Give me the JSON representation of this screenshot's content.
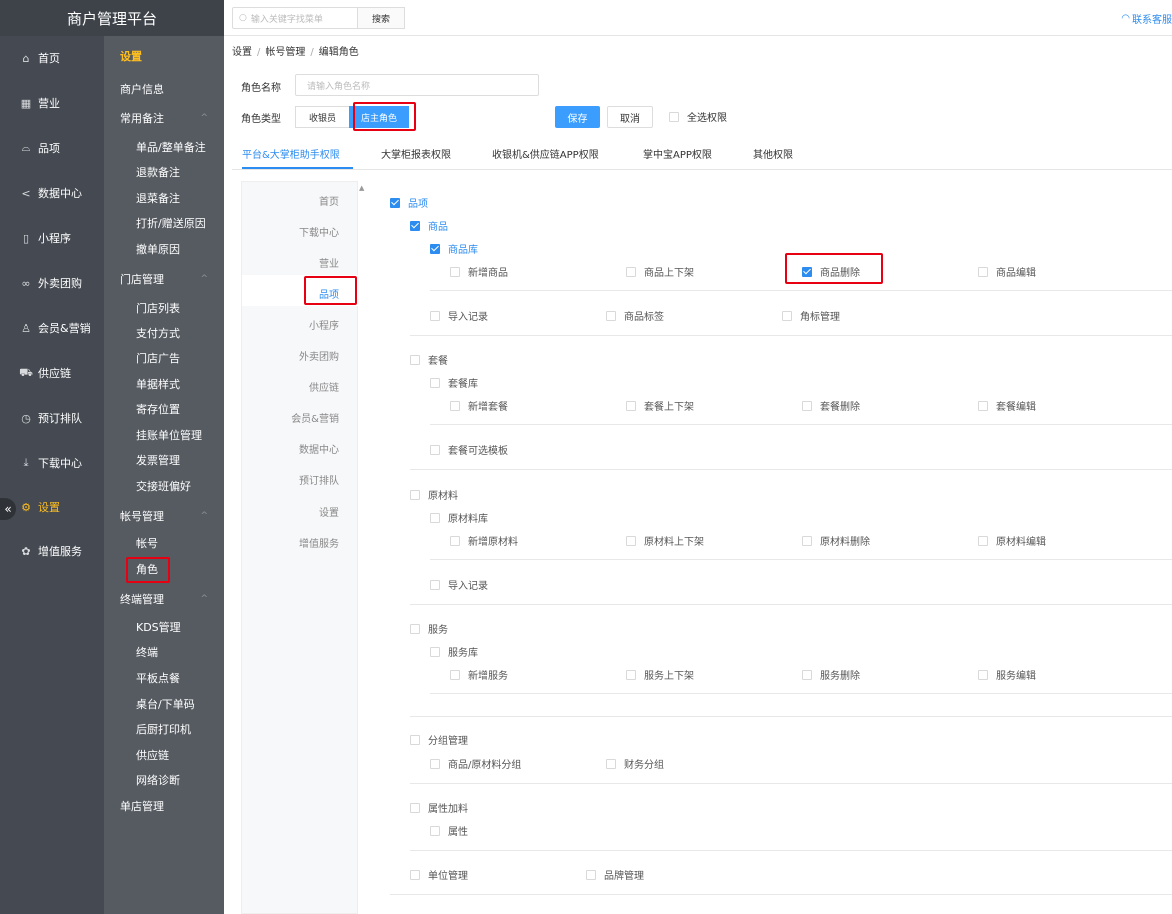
{
  "app": {
    "title": "商户管理平台"
  },
  "rail": [
    {
      "label": "首页",
      "icon": "home-icon",
      "glyph": "⌂"
    },
    {
      "label": "营业",
      "icon": "calendar-icon",
      "glyph": "▦"
    },
    {
      "label": "品项",
      "icon": "bag-icon",
      "glyph": "⌓"
    },
    {
      "label": "数据中心",
      "icon": "share-icon",
      "glyph": "<"
    },
    {
      "label": "小程序",
      "icon": "tablet-icon",
      "glyph": "▯"
    },
    {
      "label": "外卖团购",
      "icon": "bike-icon",
      "glyph": "∞"
    },
    {
      "label": "会员&营销",
      "icon": "user-icon",
      "glyph": "♙"
    },
    {
      "label": "供应链",
      "icon": "truck-icon",
      "glyph": "⛟"
    },
    {
      "label": "预订排队",
      "icon": "clock-icon",
      "glyph": "◷"
    },
    {
      "label": "下载中心",
      "icon": "download-icon",
      "glyph": "⤓"
    },
    {
      "label": "设置",
      "icon": "gear-icon",
      "glyph": "⚙"
    },
    {
      "label": "增值服务",
      "icon": "gift-icon",
      "glyph": "✿"
    }
  ],
  "sub": {
    "title": "设置",
    "items": [
      {
        "t": "c0",
        "label": "商户信息"
      },
      {
        "t": "h",
        "label": "常用备注"
      },
      {
        "t": "c",
        "label": "单品/整单备注"
      },
      {
        "t": "c",
        "label": "退款备注"
      },
      {
        "t": "c",
        "label": "退菜备注"
      },
      {
        "t": "c",
        "label": "打折/赠送原因"
      },
      {
        "t": "c",
        "label": "撤单原因"
      },
      {
        "t": "h",
        "label": "门店管理"
      },
      {
        "t": "c",
        "label": "门店列表"
      },
      {
        "t": "c",
        "label": "支付方式"
      },
      {
        "t": "c",
        "label": "门店广告"
      },
      {
        "t": "c",
        "label": "单据样式"
      },
      {
        "t": "c",
        "label": "寄存位置"
      },
      {
        "t": "c",
        "label": "挂账单位管理"
      },
      {
        "t": "c",
        "label": "发票管理"
      },
      {
        "t": "c",
        "label": "交接班偏好"
      },
      {
        "t": "h",
        "label": "帐号管理"
      },
      {
        "t": "c",
        "label": "帐号"
      },
      {
        "t": "c",
        "label": "角色"
      },
      {
        "t": "h",
        "label": "终端管理"
      },
      {
        "t": "c",
        "label": "KDS管理"
      },
      {
        "t": "c",
        "label": "终端"
      },
      {
        "t": "c",
        "label": "平板点餐"
      },
      {
        "t": "c",
        "label": "桌台/下单码"
      },
      {
        "t": "c",
        "label": "后厨打印机"
      },
      {
        "t": "c",
        "label": "供应链"
      },
      {
        "t": "c",
        "label": "网络诊断"
      },
      {
        "t": "c0",
        "label": "单店管理"
      }
    ]
  },
  "topbar": {
    "search_placeholder": "输入关键字找菜单",
    "search_button": "搜索",
    "contact": "联系客服"
  },
  "breadcrumb": [
    "设置",
    "帐号管理",
    "编辑角色"
  ],
  "form": {
    "name_label": "角色名称",
    "name_placeholder": "请输入角色名称",
    "type_label": "角色类型",
    "type_options": [
      "收银员",
      "店主角色"
    ],
    "type_selected": "店主角色",
    "save": "保存",
    "cancel": "取消",
    "select_all": "全选权限"
  },
  "tabs": [
    "平台&大掌柜助手权限",
    "大掌柜报表权限",
    "收银机&供应链APP权限",
    "掌中宝APP权限",
    "其他权限"
  ],
  "categories": [
    "首页",
    "下载中心",
    "营业",
    "品项",
    "小程序",
    "外卖团购",
    "供应链",
    "会员&营销",
    "数据中心",
    "预订排队",
    "设置",
    "增值服务"
  ],
  "active_category": "品项",
  "perms": [
    {
      "label": "品项",
      "checked": true
    },
    {
      "label": "商品",
      "checked": true
    },
    {
      "label": "商品库",
      "checked": true
    },
    {
      "label": "新增商品",
      "checked": false
    },
    {
      "label": "商品上下架",
      "checked": false
    },
    {
      "label": "商品删除",
      "checked": true
    },
    {
      "label": "商品编辑",
      "checked": false
    },
    {
      "label": "导入记录",
      "checked": false
    },
    {
      "label": "商品标签",
      "checked": false
    },
    {
      "label": "角标管理",
      "checked": false
    },
    {
      "label": "套餐",
      "checked": false
    },
    {
      "label": "套餐库",
      "checked": false
    },
    {
      "label": "新增套餐",
      "checked": false
    },
    {
      "label": "套餐上下架",
      "checked": false
    },
    {
      "label": "套餐删除",
      "checked": false
    },
    {
      "label": "套餐编辑",
      "checked": false
    },
    {
      "label": "套餐可选模板",
      "checked": false
    },
    {
      "label": "原材料",
      "checked": false
    },
    {
      "label": "原材料库",
      "checked": false
    },
    {
      "label": "新增原材料",
      "checked": false
    },
    {
      "label": "原材料上下架",
      "checked": false
    },
    {
      "label": "原材料删除",
      "checked": false
    },
    {
      "label": "原材料编辑",
      "checked": false
    },
    {
      "label": "导入记录",
      "checked": false
    },
    {
      "label": "服务",
      "checked": false
    },
    {
      "label": "服务库",
      "checked": false
    },
    {
      "label": "新增服务",
      "checked": false
    },
    {
      "label": "服务上下架",
      "checked": false
    },
    {
      "label": "服务删除",
      "checked": false
    },
    {
      "label": "服务编辑",
      "checked": false
    },
    {
      "label": "分组管理",
      "checked": false
    },
    {
      "label": "商品/原材料分组",
      "checked": false
    },
    {
      "label": "财务分组",
      "checked": false
    },
    {
      "label": "属性加料",
      "checked": false
    },
    {
      "label": "属性",
      "checked": false
    },
    {
      "label": "单位管理",
      "checked": false
    },
    {
      "label": "品牌管理",
      "checked": false
    }
  ],
  "colors": {
    "accent": "#2d8cf0",
    "active_menu": "#ffbf1f",
    "highlight": "#e60012",
    "save_button": "#3b9eff"
  }
}
